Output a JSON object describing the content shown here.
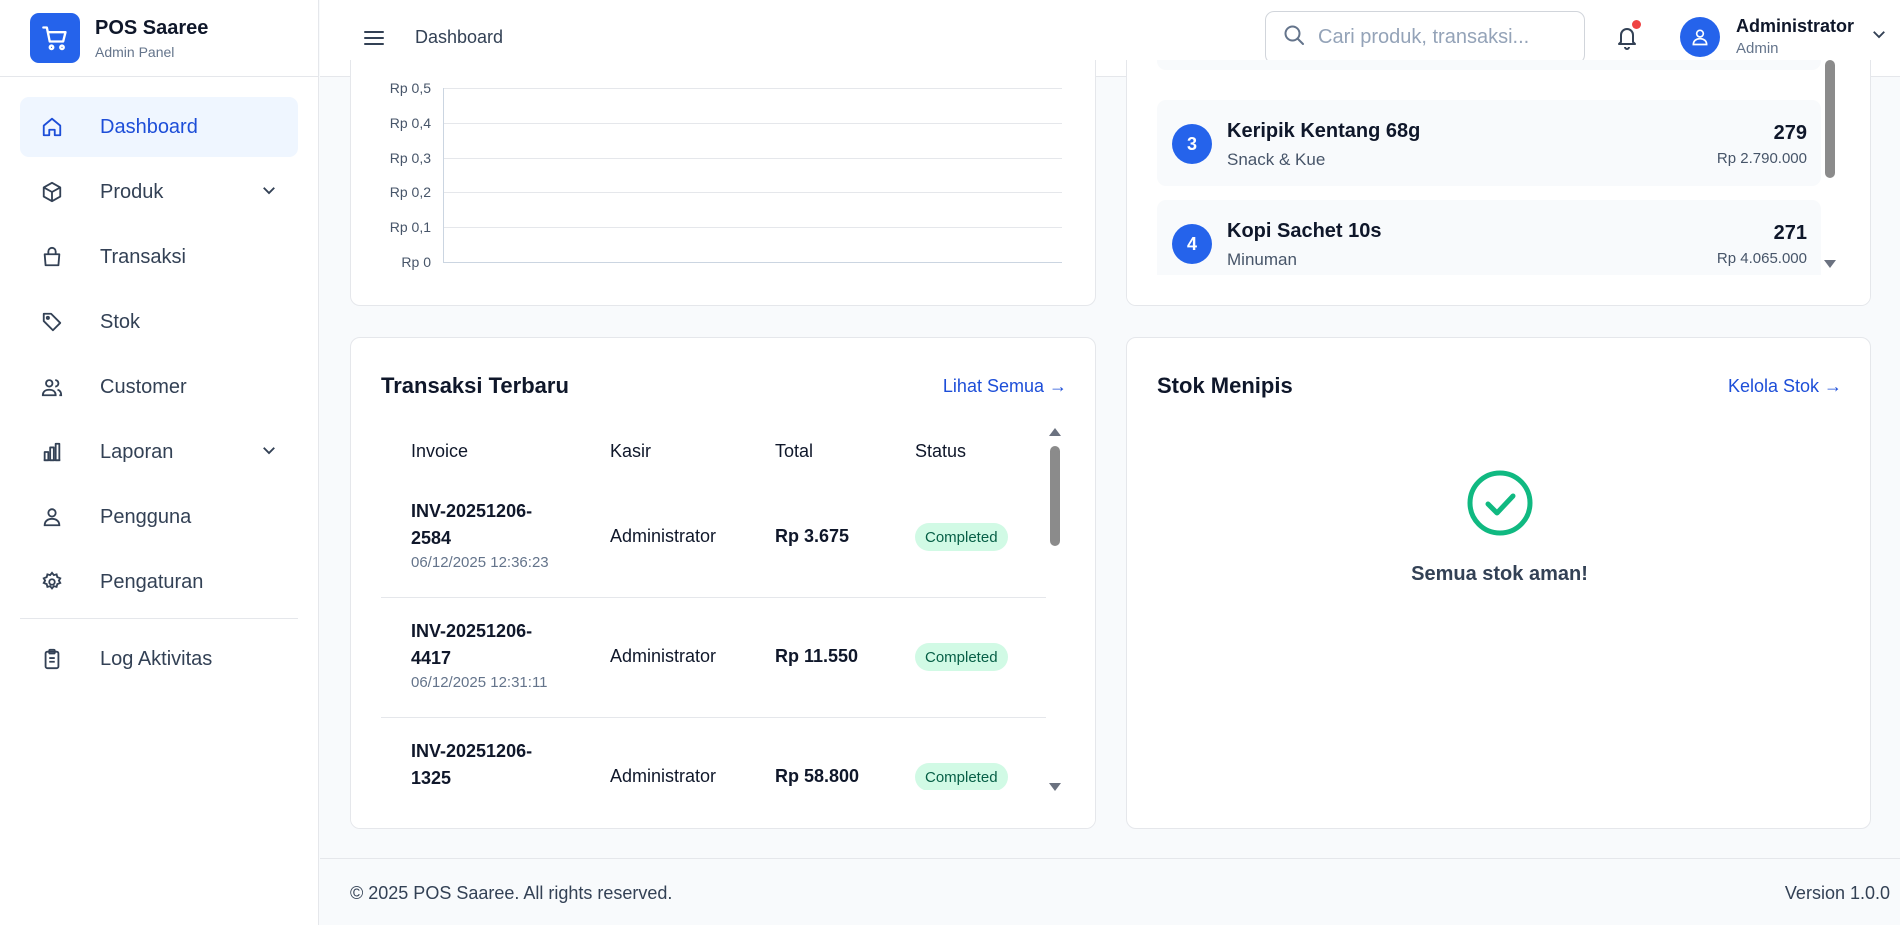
{
  "brand": {
    "title": "POS Saaree",
    "subtitle": "Admin Panel"
  },
  "sidebar": {
    "items": [
      {
        "label": "Dashboard",
        "icon": "home-icon",
        "active": true
      },
      {
        "label": "Produk",
        "icon": "box-icon",
        "expandable": true
      },
      {
        "label": "Transaksi",
        "icon": "shopping-bag-icon"
      },
      {
        "label": "Stok",
        "icon": "tag-icon"
      },
      {
        "label": "Customer",
        "icon": "users-icon"
      },
      {
        "label": "Laporan",
        "icon": "bar-chart-icon",
        "expandable": true
      },
      {
        "label": "Pengguna",
        "icon": "user-icon"
      },
      {
        "label": "Pengaturan",
        "icon": "gear-icon"
      },
      {
        "label": "Log Aktivitas",
        "icon": "clipboard-icon"
      }
    ]
  },
  "topbar": {
    "breadcrumb": "Dashboard",
    "search_placeholder": "Cari produk, transaksi...",
    "user_name": "Administrator",
    "user_role": "Admin"
  },
  "chart": {
    "ticks": [
      "Rp 0,5",
      "Rp 0,4",
      "Rp 0,3",
      "Rp 0,2",
      "Rp 0,1",
      "Rp 0"
    ]
  },
  "chart_data": {
    "type": "line",
    "x": [],
    "series": [],
    "title": "",
    "xlabel": "",
    "ylabel": "",
    "ylim": [
      0,
      0.5
    ],
    "yticks": [
      "Rp 0,5",
      "Rp 0,4",
      "Rp 0,3",
      "Rp 0,2",
      "Rp 0,1",
      "Rp 0"
    ],
    "grid": true
  },
  "top_products": [
    {
      "rank": "3",
      "name": "Keripik Kentang 68g",
      "category": "Snack & Kue",
      "qty": "279",
      "revenue": "Rp 2.790.000"
    },
    {
      "rank": "4",
      "name": "Kopi Sachet 10s",
      "category": "Minuman",
      "qty": "271",
      "revenue": "Rp 4.065.000"
    }
  ],
  "transactions": {
    "title": "Transaksi Terbaru",
    "link": "Lihat Semua →",
    "headers": {
      "invoice": "Invoice",
      "kasir": "Kasir",
      "total": "Total",
      "status": "Status"
    },
    "rows": [
      {
        "invoice": "INV-20251206-2584",
        "date": "06/12/2025 12:36:23",
        "kasir": "Administrator",
        "total": "Rp 3.675",
        "status": "Completed"
      },
      {
        "invoice": "INV-20251206-4417",
        "date": "06/12/2025 12:31:11",
        "kasir": "Administrator",
        "total": "Rp 11.550",
        "status": "Completed"
      },
      {
        "invoice": "INV-20251206-1325",
        "date": "",
        "kasir": "Administrator",
        "total": "Rp 58.800",
        "status": "Completed"
      }
    ]
  },
  "low_stock": {
    "title": "Stok Menipis",
    "link": "Kelola Stok →",
    "empty_text": "Semua stok aman!",
    "icon": "check-circle-icon"
  },
  "footer": {
    "copyright": "© 2025 POS Saaree. All rights reserved.",
    "version": "Version 1.0.0"
  },
  "colors": {
    "accent": "#2563eb",
    "success": "#10b981",
    "badge_bg": "#d1fae5",
    "alert": "#ef4444"
  }
}
